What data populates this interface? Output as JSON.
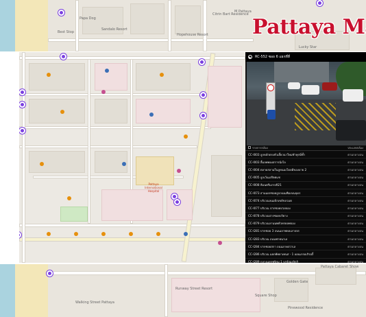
{
  "logo": {
    "text": "Pattaya Mail"
  },
  "map_labels": {
    "top": [
      "Papa Dog",
      "Best Stop",
      "Sandalo Resort",
      "Hopehouse Resort",
      "Citrin Bart Residence",
      "M Pattaya",
      "Lucky Star"
    ],
    "hospital": "Pattaya International Hospital",
    "bottom": [
      "Runway Street Resort",
      "Square Shop",
      "Walking Street Pattaya",
      "Pinewood Residence",
      "Pattaya Cabaret Show",
      "Golden Gate"
    ]
  },
  "camera": {
    "title": "RC-552 ซอย 6 แยกที่สี่",
    "list_header_left": "รายการกล้อง",
    "list_header_right": "ประเภทกล้อง",
    "rows": [
      {
        "name": "CC-I003 ลูกหลักตรงหัวเลี้ยวนาใหม่ชำทุกนี่ซ้ำ",
        "type": "ตามกลางถน"
      },
      {
        "name": "CC-I003 ลื้มลพพองสรารนังไล",
        "type": "ตามกลางถน"
      },
      {
        "name": "CC-I004 ตลาดสลามในลูหนองโดยมีของบาย 2",
        "type": "ตามกลางถน"
      },
      {
        "name": "CC-I005 ลูกเว้นเอรีตตแช",
        "type": "ตามกลางถน"
      },
      {
        "name": "CC-I008 ลีมนตรีเเกรงปี21",
        "type": "ตามกลางถน"
      },
      {
        "name": "CC-I073 สามแยกซอยลูกถนนเฟืองบนจุดร",
        "type": "ตามกลางถน"
      },
      {
        "name": "CC-I074 บริเวณลนมปักเขย์ขลวมต",
        "type": "ตามกลางถน"
      },
      {
        "name": "CC-I077 บริเวณ ปากซอยปวยจอง",
        "type": "ตามกลางถน"
      },
      {
        "name": "CC-I078 บริเวณปากซอยบวิยาง",
        "type": "ตามกลางถน"
      },
      {
        "name": "CC-I079 บริเวณลานนพหัวทรยลพจอง",
        "type": "ตามกลางถน"
      },
      {
        "name": "CC-I281 ปากซอย 3 ถนนเลาพหลเลาจจร",
        "type": "ตามกลางถน"
      },
      {
        "name": "CC-I283 บริเวณ ถนนฟาทนาเล",
        "type": "ตามกลางถน"
      },
      {
        "name": "CC-I284 ปากซอยสกา ถนนลาคสวาเล",
        "type": "ตามกลางถน"
      },
      {
        "name": "CC-I286 บริเวณ แยกพัทยาเทนส - 1 ออนเกรอเกิรองี้",
        "type": "ตามกลางถน"
      },
      {
        "name": "CC-I289 กลางแยกฟูจิกุม 1 บรจังมงลิกกิ",
        "type": "ตามกลางถน"
      }
    ]
  },
  "colors": {
    "brand": "#c8102e",
    "camera_marker": "#7a3fe0",
    "poi": "#e6900d"
  }
}
